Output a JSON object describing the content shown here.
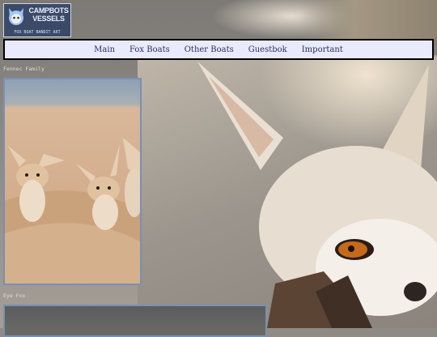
{
  "logo": {
    "title": "CAMPBOTS VESSELS",
    "tagline": "FOX BOAT BANDIT ART"
  },
  "nav": {
    "items": [
      "Main",
      "Fox Boats",
      "Other Boats",
      "Guestbok",
      "Important"
    ]
  },
  "gallery": [
    {
      "caption": "Fennec Family"
    },
    {
      "caption": "Eye Fox"
    }
  ]
}
